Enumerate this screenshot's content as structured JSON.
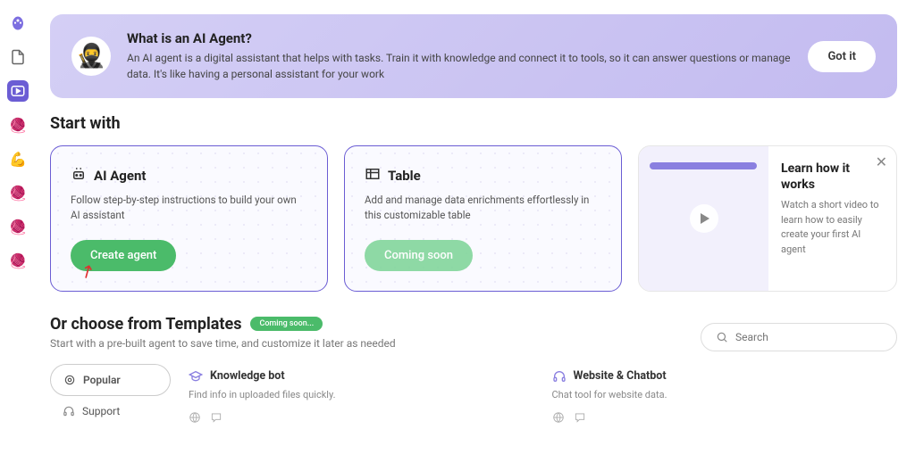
{
  "banner": {
    "title": "What is an AI Agent?",
    "description": "An AI agent is a digital assistant that helps with tasks. Train it with knowledge and connect it to tools, so it can answer questions or manage data. It's like having a personal assistant for your work",
    "button": "Got it"
  },
  "section_title": "Start with",
  "cards": {
    "agent": {
      "title": "AI Agent",
      "description": "Follow step-by-step instructions to build your own AI assistant",
      "button": "Create agent"
    },
    "table": {
      "title": "Table",
      "description": "Add and manage data enrichments effortlessly in this customizable table",
      "button": "Coming soon"
    }
  },
  "learn": {
    "title": "Learn how it works",
    "description": "Watch a short video to learn how to easily create your first AI agent"
  },
  "templates": {
    "title": "Or choose from Templates",
    "badge": "Coming soon...",
    "subtitle": "Start with a pre-built agent to save time, and customize it later as needed",
    "nav": {
      "popular": "Popular",
      "support": "Support"
    },
    "items": [
      {
        "title": "Knowledge bot",
        "description": "Find info in uploaded files quickly."
      },
      {
        "title": "Website & Chatbot",
        "description": "Chat tool for website data."
      }
    ]
  },
  "search": {
    "placeholder": "Search"
  }
}
